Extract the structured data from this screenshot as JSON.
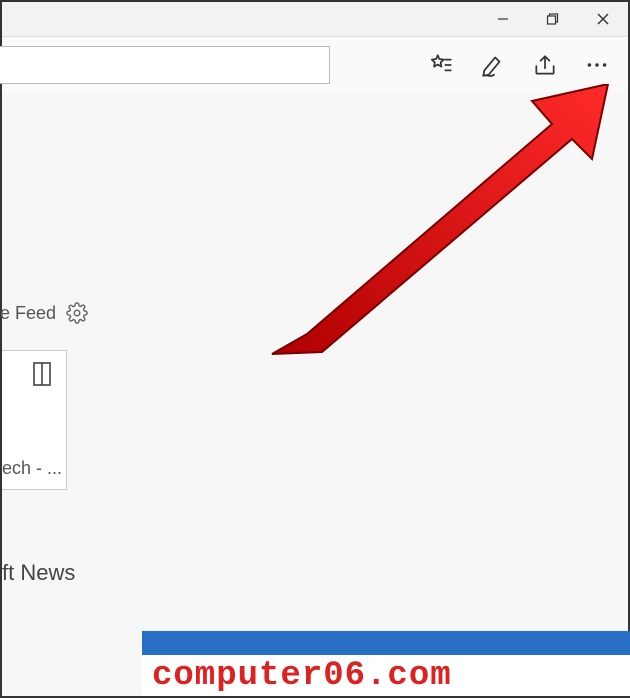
{
  "toolbar": {
    "icons": {
      "favorites": "favorites-list-icon",
      "notes": "pen-icon",
      "share": "share-icon",
      "more": "more-icon"
    }
  },
  "window": {
    "icons": {
      "minimize": "minimize-icon",
      "restore": "restore-icon",
      "close": "close-icon"
    }
  },
  "content": {
    "feed_label": "e Feed",
    "card_label": "ech - ...",
    "news_label": "ft News"
  },
  "watermark": "computer06.com"
}
